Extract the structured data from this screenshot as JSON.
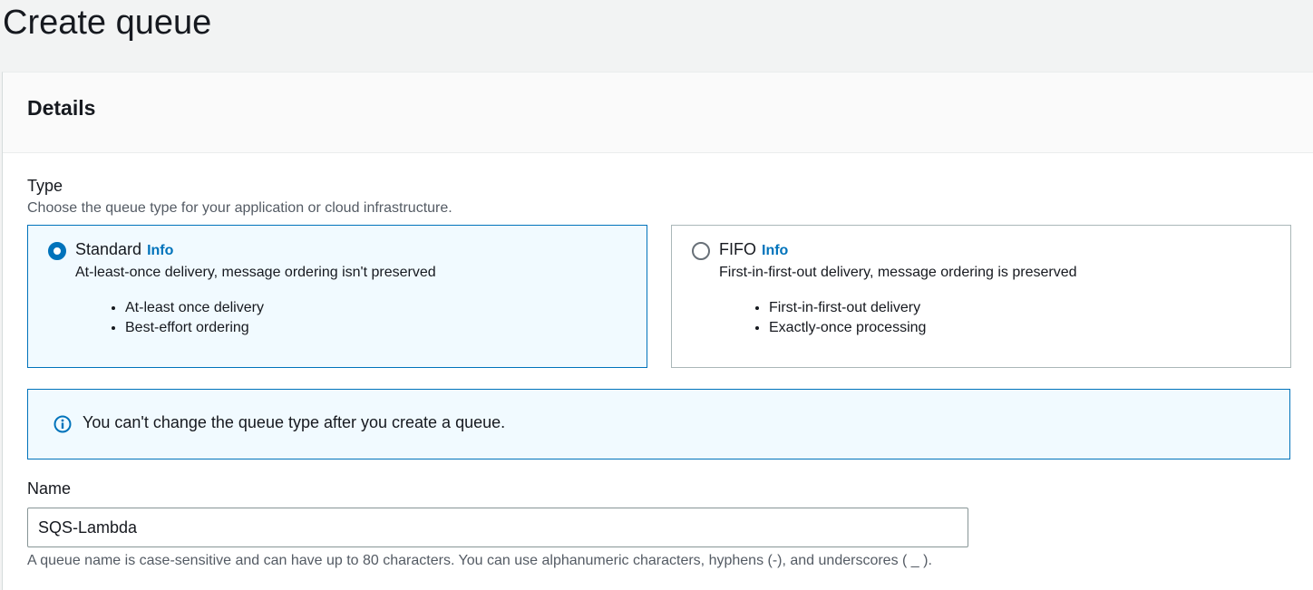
{
  "page": {
    "title": "Create queue"
  },
  "details": {
    "title": "Details",
    "type": {
      "label": "Type",
      "description": "Choose the queue type for your application or cloud infrastructure.",
      "options": [
        {
          "title": "Standard",
          "info": "Info",
          "description": "At-least-once delivery, message ordering isn't preserved",
          "bullets": [
            "At-least once delivery",
            "Best-effort ordering"
          ],
          "selected": true
        },
        {
          "title": "FIFO",
          "info": "Info",
          "description": "First-in-first-out delivery, message ordering is preserved",
          "bullets": [
            "First-in-first-out delivery",
            "Exactly-once processing"
          ],
          "selected": false
        }
      ]
    },
    "alert": {
      "icon": "info-icon",
      "text": "You can't change the queue type after you create a queue."
    },
    "name": {
      "label": "Name",
      "value": "SQS-Lambda",
      "hint": "A queue name is case-sensitive and can have up to 80 characters. You can use alphanumeric characters, hyphens (-), and underscores ( _ )."
    }
  },
  "colors": {
    "accent": "#0073bb",
    "selected_bg": "#f1faff",
    "text": "#16191f",
    "muted_text": "#545b64"
  }
}
